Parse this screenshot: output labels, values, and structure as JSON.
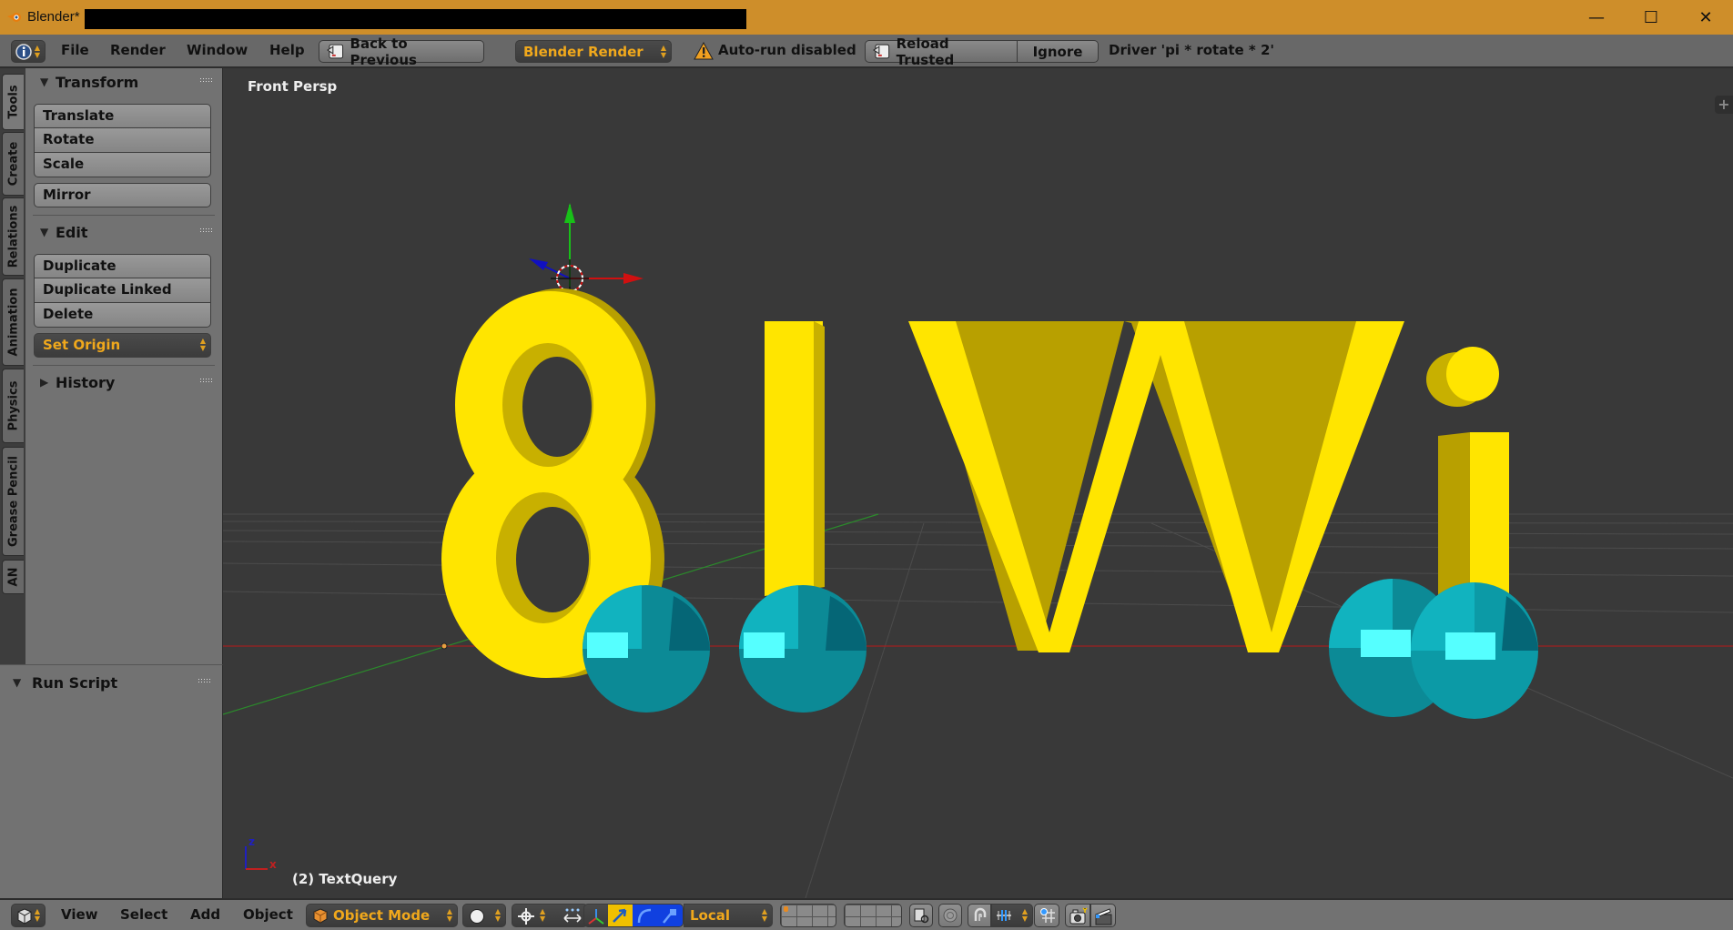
{
  "window": {
    "title": "Blender*",
    "title_redacted": true,
    "controls": {
      "minimize": "—",
      "maximize": "☐",
      "close": "✕"
    }
  },
  "topbar": {
    "editor_type_icon": "info-icon",
    "menus": [
      "File",
      "Render",
      "Window",
      "Help"
    ],
    "back_to_previous": "Back to Previous",
    "render_engine": "Blender Render",
    "warning_text": "Auto-run disabled",
    "reload_trusted": "Reload Trusted",
    "ignore": "Ignore",
    "driver_message": "Driver 'pi * rotate * 2'"
  },
  "tabs": [
    "Tools",
    "Create",
    "Relations",
    "Animation",
    "Physics",
    "Grease Pencil",
    "AN"
  ],
  "active_tab": "Tools",
  "tool_panel": {
    "transform": {
      "title": "Transform",
      "expanded": true,
      "buttons": [
        "Translate",
        "Rotate",
        "Scale"
      ],
      "mirror": "Mirror"
    },
    "edit": {
      "title": "Edit",
      "expanded": true,
      "buttons": [
        "Duplicate",
        "Duplicate Linked",
        "Delete"
      ],
      "set_origin": "Set Origin"
    },
    "history": {
      "title": "History",
      "expanded": false
    }
  },
  "operator_panel": {
    "title": "Run Script",
    "expanded": true
  },
  "viewport": {
    "view_label": "Front Persp",
    "object_label": "(2) TextQuery",
    "axis_z": "z",
    "axis_x": "x",
    "scene_text": "8lWi",
    "colors": {
      "background": "#393939",
      "text_mesh": "#FFE500",
      "spheres": "#0FA3B1",
      "x_axis": "#C81E1E",
      "y_axis": "#228B22"
    }
  },
  "bottombar": {
    "menus": [
      "View",
      "Select",
      "Add",
      "Object"
    ],
    "mode": "Object Mode",
    "orientation": "Local"
  }
}
